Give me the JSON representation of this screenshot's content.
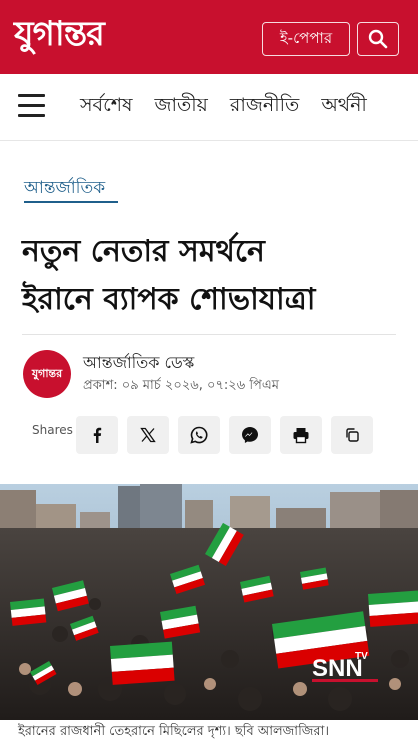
{
  "header": {
    "logo_text": "যুগান্তর",
    "epaper_label": "ই-পেপার",
    "search_icon": "search-icon",
    "brand_color": "#c8102e"
  },
  "nav": {
    "menu_icon": "hamburger-menu-icon",
    "items": [
      "সর্বশেষ",
      "জাতীয়",
      "রাজনীতি",
      "অর্থনী"
    ]
  },
  "article": {
    "category": "আন্তর্জাতিক",
    "headline_line1": "নতুন নেতার সমর্থনে",
    "headline_line2": "ইরানে ব্যাপক শোভাযাত্রা",
    "author": {
      "avatar_text": "যুগান্তর",
      "name": "আন্তর্জাতিক ডেস্ক",
      "published": "প্রকাশ: ০৯ মার্চ ২০২৬, ০৭:২৬ পিএম"
    },
    "shares_label": "Shares",
    "share_buttons": [
      "facebook-icon",
      "x-icon",
      "whatsapp-icon",
      "messenger-icon",
      "print-icon",
      "copy-icon"
    ],
    "image": {
      "watermark": "SNN",
      "watermark_small": "TV"
    },
    "caption": "ইরানের রাজধানী তেহরানে মিছিলের দৃশ্য। ছবি আলজাজিরা।"
  }
}
